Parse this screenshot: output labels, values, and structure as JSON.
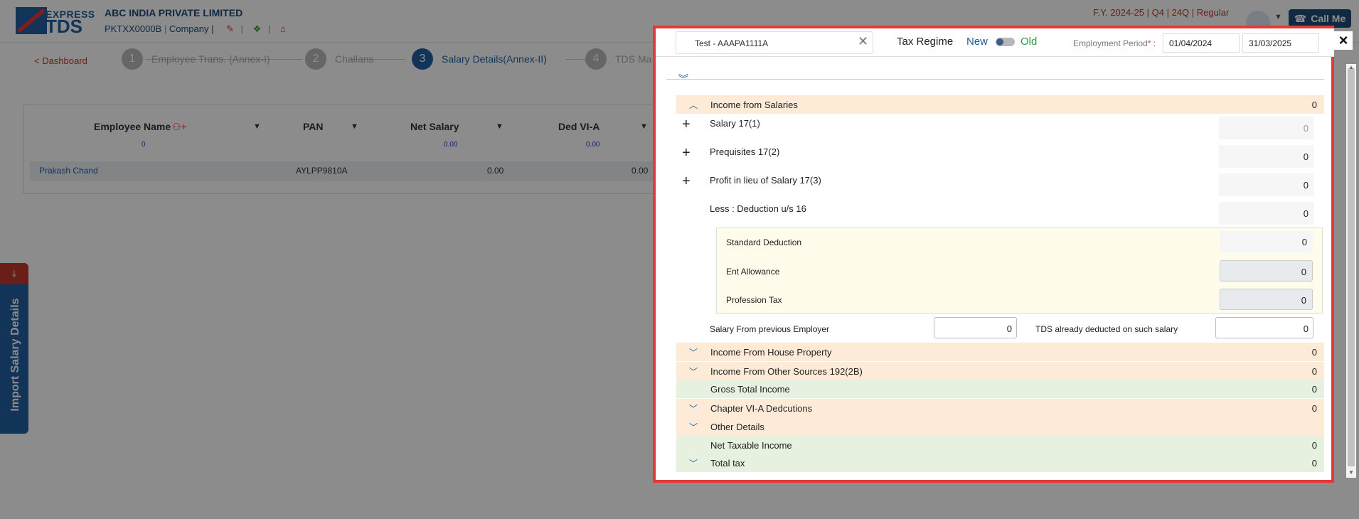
{
  "app": {
    "logo_express": "EXPRESS",
    "logo_tds": "TDS",
    "company_name": "ABC INDIA PRIVATE LIMITED",
    "tan": "PKTXX0000B",
    "company_type": "Company |",
    "fy_line": "F.Y. 2024-25  | Q4  | 24Q | Regular",
    "call_me": "Call Me"
  },
  "steps": {
    "dashboard": "< Dashboard",
    "items": [
      {
        "num": "1",
        "label": "Employee Trans. (Annex-I)"
      },
      {
        "num": "2",
        "label": "Challans"
      },
      {
        "num": "3",
        "label": "Salary Details(Annex-II)"
      },
      {
        "num": "4",
        "label": "TDS Ma"
      }
    ]
  },
  "grid": {
    "headers": [
      "Employee Name",
      "PAN",
      "Net Salary",
      "Ded VI-A"
    ],
    "subtotals": [
      "0",
      "",
      "0.00",
      "0.00"
    ],
    "row": {
      "name": "Prakash Chand",
      "pan": "AYLPP9810A",
      "net_salary": "0.00",
      "ded": "0.00"
    }
  },
  "import_tab": {
    "label": "Import Salary Details"
  },
  "panel": {
    "employee": "Test - AAAPA1111A",
    "tax_regime_label": "Tax Regime",
    "regime_new": "New",
    "regime_old": "Old",
    "employment_period_label": "Employment Period",
    "employment_period_req": "* :",
    "date_from": "01/04/2024",
    "date_to": "31/03/2025",
    "close": "×",
    "sections": {
      "income_salaries": {
        "label": "Income from Salaries",
        "value": "0"
      },
      "salary_171": {
        "label": "Salary 17(1)",
        "value": "0"
      },
      "prequisites": {
        "label": "Prequisites 17(2)",
        "value": "0"
      },
      "profit_lieu": {
        "label": "Profit in lieu of Salary 17(3)",
        "value": "0"
      },
      "less_ded": {
        "label": "Less : Deduction u/s 16",
        "value": "0"
      },
      "std_ded": {
        "label": "Standard Deduction",
        "value": "0"
      },
      "ent_allow": {
        "label": "Ent Allowance",
        "value": "0"
      },
      "prof_tax": {
        "label": "Profession Tax",
        "value": "0"
      },
      "prev_employer": {
        "label": "Salary From previous Employer",
        "value": "0"
      },
      "tds_deducted": {
        "label": "TDS already deducted on such salary",
        "value": "0"
      },
      "house_property": {
        "label": "Income From House Property",
        "value": "0"
      },
      "other_sources": {
        "label": "Income From Other Sources 192(2B)",
        "value": "0"
      },
      "gross_total": {
        "label": "Gross Total Income",
        "value": "0"
      },
      "chapter_via": {
        "label": "Chapter VI-A Dedcutions",
        "value": "0"
      },
      "other_details": {
        "label": "Other Details",
        "value": ""
      },
      "net_taxable": {
        "label": "Net Taxable Income",
        "value": "0"
      },
      "total_tax": {
        "label": "Total tax",
        "value": "0"
      }
    }
  }
}
